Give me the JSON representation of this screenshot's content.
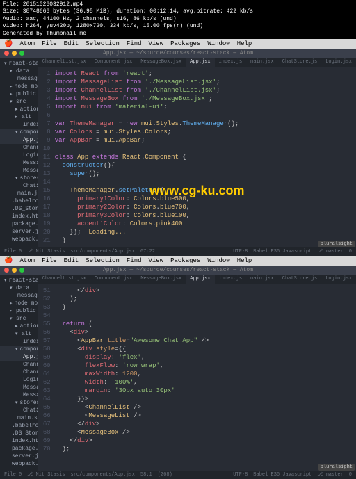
{
  "meta": {
    "l1": "File: 20151026032912.mp4",
    "l2": "Size: 38748666 bytes (36.95 MiB), duration: 00:12:14, avg.bitrate: 422 kb/s",
    "l3": "Audio: aac, 44100 Hz, 2 channels, s16, 86 kb/s (und)",
    "l4": "Video: h264, yuv420p, 1280x720, 334 kb/s, 15.00 fps(r) (und)",
    "l5": "Generated by Thumbnail me"
  },
  "osmenu": [
    "Atom",
    "File",
    "Edit",
    "Selection",
    "Find",
    "View",
    "Packages",
    "Window",
    "Help"
  ],
  "title": "App.jsx — ~/source/courses/react-stack — Atom",
  "tabs": [
    "ChannelList.jsx",
    "Component.jsx",
    "MessageBox.jsx",
    "App.jsx",
    "index.js",
    "main.jsx",
    "ChatStore.js",
    "Login.jsx"
  ],
  "active_tab": "App.jsx",
  "tree1": [
    {
      "t": "react-stack",
      "d": 0,
      "f": 1,
      "o": 1
    },
    {
      "t": "data",
      "d": 1,
      "f": 1,
      "o": 1
    },
    {
      "t": "messages.json",
      "d": 2
    },
    {
      "t": "node_modules",
      "d": 1,
      "f": 1
    },
    {
      "t": "public",
      "d": 1,
      "f": 1
    },
    {
      "t": "src",
      "d": 1,
      "f": 1,
      "o": 1
    },
    {
      "t": "actions",
      "d": 2,
      "f": 1
    },
    {
      "t": "alt",
      "d": 2,
      "f": 1
    },
    {
      "t": "index.js",
      "d": 3
    },
    {
      "t": "components",
      "d": 2,
      "f": 1,
      "o": 1,
      "a": 1
    },
    {
      "t": "App.jsx",
      "d": 3,
      "a": 1
    },
    {
      "t": "ChannelList.jsx",
      "d": 3
    },
    {
      "t": "Login.jsx",
      "d": 3
    },
    {
      "t": "MessageBox.jsx",
      "d": 3
    },
    {
      "t": "MessageList.jsx",
      "d": 3
    },
    {
      "t": "stores",
      "d": 2,
      "f": 1,
      "o": 1
    },
    {
      "t": "ChatStore.js",
      "d": 3
    },
    {
      "t": "main.jsx",
      "d": 2
    },
    {
      "t": ".babelrc",
      "d": 1
    },
    {
      "t": ".DS_Store",
      "d": 1
    },
    {
      "t": "index.html",
      "d": 1
    },
    {
      "t": "package.json",
      "d": 1
    },
    {
      "t": "server.js",
      "d": 1
    },
    {
      "t": "webpack.config.js",
      "d": 1
    }
  ],
  "tree2": [
    {
      "t": "react-stack",
      "d": 0,
      "f": 1,
      "o": 1
    },
    {
      "t": "data",
      "d": 1,
      "f": 1,
      "o": 1
    },
    {
      "t": "messages.json",
      "d": 2
    },
    {
      "t": "node_modules",
      "d": 1,
      "f": 1
    },
    {
      "t": "public",
      "d": 1,
      "f": 1
    },
    {
      "t": "src",
      "d": 1,
      "f": 1,
      "o": 1
    },
    {
      "t": "actions",
      "d": 2,
      "f": 1
    },
    {
      "t": "alt",
      "d": 2,
      "f": 1,
      "o": 1
    },
    {
      "t": "index.js",
      "d": 3
    },
    {
      "t": "components",
      "d": 2,
      "f": 1,
      "o": 1,
      "a": 1
    },
    {
      "t": "App.jsx",
      "d": 3,
      "a": 1
    },
    {
      "t": "Channel.jsx",
      "d": 3
    },
    {
      "t": "ChannelList.jsx",
      "d": 3
    },
    {
      "t": "Login.jsx",
      "d": 3
    },
    {
      "t": "MessageBox.jsx",
      "d": 3
    },
    {
      "t": "MessageList.jsx",
      "d": 3
    },
    {
      "t": "stores",
      "d": 2,
      "f": 1,
      "o": 1
    },
    {
      "t": "ChatStore.js",
      "d": 3
    },
    {
      "t": "main.scss",
      "d": 2
    },
    {
      "t": ".babelrc",
      "d": 1
    },
    {
      "t": ".DS_Store",
      "d": 1
    },
    {
      "t": "index.html",
      "d": 1
    },
    {
      "t": "package.json",
      "d": 1
    },
    {
      "t": "server.js",
      "d": 1
    },
    {
      "t": "webpack.config.js",
      "d": 1
    }
  ],
  "code1_start": 1,
  "code1": [
    "<span class='kw'>import</span> <span class='var'>React</span> <span class='kw'>from</span> <span class='str'>'react'</span>;",
    "<span class='kw'>import</span> <span class='var'>MessageList</span> <span class='kw'>from</span> <span class='str'>'./MessageList.jsx'</span>;",
    "<span class='kw'>import</span> <span class='var'>ChannelList</span> <span class='kw'>from</span> <span class='str'>'./ChannelList.jsx'</span>;",
    "<span class='kw'>import</span> <span class='var'>MessageBox</span> <span class='kw'>from</span> <span class='str'>'./MessageBox.jsx'</span>;",
    "<span class='kw'>import</span> <span class='var'>mui</span> <span class='kw'>from</span> <span class='str'>'material-ui'</span>;",
    "",
    "<span class='kw'>var</span> <span class='var'>ThemeManager</span> = <span class='kw'>new</span> <span class='prop'>mui</span>.<span class='prop'>Styles</span>.<span class='fn'>ThemeManager</span>();",
    "<span class='kw'>var</span> <span class='var'>Colors</span> = <span class='prop'>mui</span>.<span class='prop'>Styles</span>.<span class='prop'>Colors</span>;",
    "<span class='kw'>var</span> <span class='var'>AppBar</span> = <span class='prop'>mui</span>.<span class='prop'>AppBar</span>;",
    "",
    "<span class='kw'>class</span> <span class='comp'>App</span> <span class='kw'>extends</span> <span class='comp'>React</span>.<span class='comp'>Component</span> {",
    "  <span class='fn'>constructor</span>(){",
    "    <span class='fn'>super</span>();",
    "",
    "    <span class='prop'>ThemeManager</span>.<span class='fn'>setPalette</span>({",
    "      <span class='var'>primary1Color</span>: <span class='prop'>Colors</span>.<span class='prop'>blue500</span>,",
    "      <span class='var'>primary2Color</span>: <span class='prop'>Colors</span>.<span class='prop'>blue700</span>,",
    "      <span class='var'>primary3Color</span>: <span class='prop'>Colors</span>.<span class='prop'>blue100</span>,",
    "      <span class='var'>accent1Color</span>: <span class='prop'>Colors</span>.<span class='prop'>pink400</span>",
    "    });  <span class='prop'>Loading...</span>",
    "  }"
  ],
  "code2_start": 51,
  "code2": [
    "      &lt;/<span class='tag'>div</span>&gt;</span>",
    "    );",
    "  }",
    "",
    "  <span class='kw'>return</span> (",
    "    &lt;<span class='tag'>div</span>&gt;",
    "      &lt;<span class='comp'>AppBar</span> <span class='attr'>title</span>=<span class='str'>\"Awesome Chat App\"</span> /&gt;",
    "      &lt;<span class='tag'>div</span> <span class='attr'>style</span>={{",
    "        <span class='var'>display</span>: <span class='str'>'flex'</span>,",
    "        <span class='var'>flexFlow</span>: <span class='str'>'row wrap'</span>,",
    "        <span class='var'>maxWidth</span>: <span class='num'>1200</span>,",
    "        <span class='var'>width</span>: <span class='str'>'100%'</span>,",
    "        <span class='var'>margin</span>: <span class='str'>'30px auto 30px'</span>",
    "      }}&gt;",
    "        &lt;<span class='comp'>ChannelList</span> /&gt;",
    "        &lt;<span class='comp'>MessageList</span> /&gt;",
    "      &lt;/<span class='tag'>div</span>&gt;",
    "      &lt;<span class='comp'>MessageBox</span> /&gt;",
    "    &lt;/<span class='tag'>div</span>&gt;",
    "  );"
  ],
  "status1": {
    "left": [
      "File 0",
      "⎇ Nit Stasis",
      "src/components/App.jsx",
      "67:22"
    ],
    "right": [
      "UTF-8",
      "Babel ES6 Javascript",
      "⎇ master",
      "0"
    ]
  },
  "status2": {
    "left": [
      "File 0",
      "⎇ Nit Stasis",
      "src/components/App.jsx",
      "58:1",
      "(268)"
    ],
    "right": [
      "UTF-8",
      "Babel ES6 Javascript",
      "⎇ master",
      "0"
    ]
  },
  "watermark": "www.cg-ku.com",
  "badge": "pluralsight"
}
